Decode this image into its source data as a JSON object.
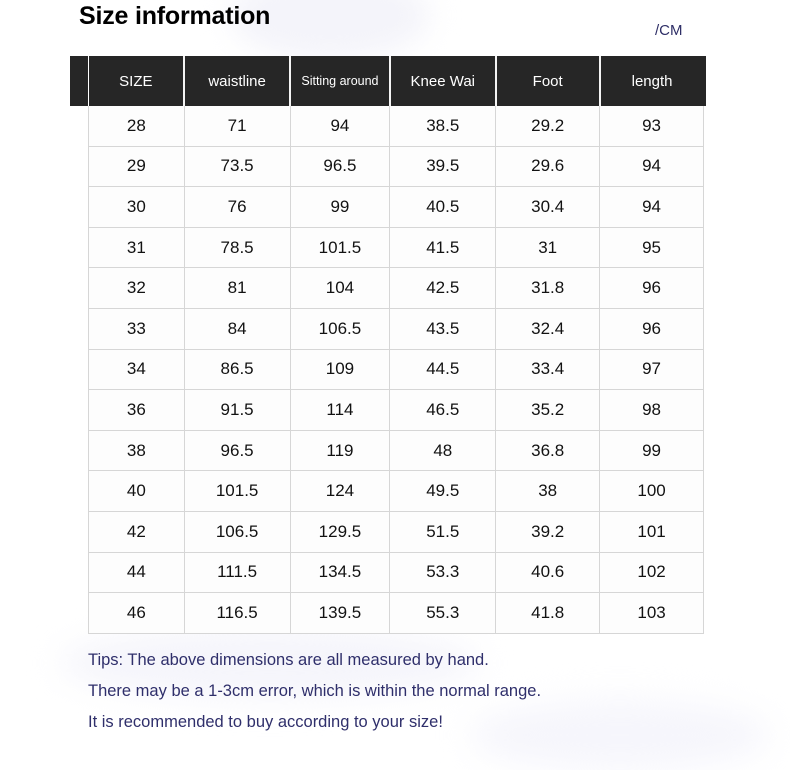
{
  "page": {
    "title": "Size information",
    "unit_label": "/CM"
  },
  "table": {
    "columns": [
      "SIZE",
      "waistline",
      "Sitting around",
      "Knee Wai",
      "Foot",
      "length"
    ],
    "rows": [
      {
        "size": "28",
        "waistline": "71",
        "sitting_around": "94",
        "knee_wai": "38.5",
        "foot": "29.2",
        "length": "93"
      },
      {
        "size": "29",
        "waistline": "73.5",
        "sitting_around": "96.5",
        "knee_wai": "39.5",
        "foot": "29.6",
        "length": "94"
      },
      {
        "size": "30",
        "waistline": "76",
        "sitting_around": "99",
        "knee_wai": "40.5",
        "foot": "30.4",
        "length": "94"
      },
      {
        "size": "31",
        "waistline": "78.5",
        "sitting_around": "101.5",
        "knee_wai": "41.5",
        "foot": "31",
        "length": "95"
      },
      {
        "size": "32",
        "waistline": "81",
        "sitting_around": "104",
        "knee_wai": "42.5",
        "foot": "31.8",
        "length": "96"
      },
      {
        "size": "33",
        "waistline": "84",
        "sitting_around": "106.5",
        "knee_wai": "43.5",
        "foot": "32.4",
        "length": "96"
      },
      {
        "size": "34",
        "waistline": "86.5",
        "sitting_around": "109",
        "knee_wai": "44.5",
        "foot": "33.4",
        "length": "97"
      },
      {
        "size": "36",
        "waistline": "91.5",
        "sitting_around": "114",
        "knee_wai": "46.5",
        "foot": "35.2",
        "length": "98"
      },
      {
        "size": "38",
        "waistline": "96.5",
        "sitting_around": "119",
        "knee_wai": "48",
        "foot": "36.8",
        "length": "99"
      },
      {
        "size": "40",
        "waistline": "101.5",
        "sitting_around": "124",
        "knee_wai": "49.5",
        "foot": "38",
        "length": "100"
      },
      {
        "size": "42",
        "waistline": "106.5",
        "sitting_around": "129.5",
        "knee_wai": "51.5",
        "foot": "39.2",
        "length": "101"
      },
      {
        "size": "44",
        "waistline": "111.5",
        "sitting_around": "134.5",
        "knee_wai": "53.3",
        "foot": "40.6",
        "length": "102"
      },
      {
        "size": "46",
        "waistline": "116.5",
        "sitting_around": "139.5",
        "knee_wai": "55.3",
        "foot": "41.8",
        "length": "103"
      }
    ]
  },
  "tips": {
    "lines": [
      "Tips: The above dimensions are all measured by hand.",
      "There may be a 1-3cm error, which is within the normal range.",
      "It is recommended to buy according to your size!"
    ]
  },
  "colors": {
    "header_background": "#262626",
    "header_text": "#ffffff",
    "body_text": "#121212",
    "cell_border": "#d6d6d6",
    "tips_text": "#2f2f6b",
    "unit_text": "#2e2e66",
    "page_background": "#ffffff"
  }
}
